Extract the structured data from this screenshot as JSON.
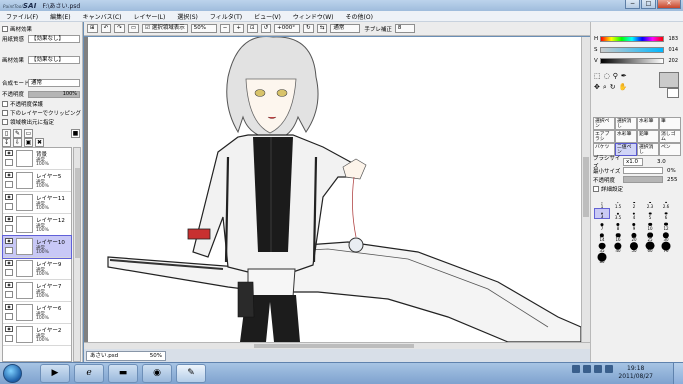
{
  "window": {
    "app_name": "PaintTool SAI",
    "app_short": "SAI",
    "app_prefix": "PaintTool",
    "title": "F:\\あさい.psd",
    "controls": [
      "−",
      "□",
      "✕"
    ]
  },
  "menu": [
    "ファイル(F)",
    "編集(E)",
    "キャンバス(C)",
    "レイヤー(L)",
    "選択(S)",
    "フィルタ(T)",
    "ビュー(V)",
    "ウィンドウ(W)",
    "その他(O)"
  ],
  "left_panel": {
    "header": "画材効果",
    "texture_label": "用紙質感",
    "texture_value": "【効果なし】",
    "material_label": "画材効果",
    "material_value": "【効果なし】",
    "blend_label": "合成モード",
    "blend_value": "通常",
    "opacity_label": "不透明度",
    "opacity_value": "100%",
    "opacity_fraction": 1.0,
    "checkboxes": [
      "不透明度保護",
      "下のレイヤーでクリッピング",
      "領域検出元に指定"
    ],
    "layer_icons": [
      "new-layer-icon",
      "new-linework-layer-icon",
      "new-folder-icon",
      "delete-layer-icon"
    ],
    "layers": [
      {
        "name": "背景",
        "mode": "通常",
        "opacity": "100%",
        "selected": false
      },
      {
        "name": "レイヤー5",
        "mode": "通常",
        "opacity": "100%",
        "selected": false
      },
      {
        "name": "レイヤー11",
        "mode": "通常",
        "opacity": "100%",
        "selected": false
      },
      {
        "name": "レイヤー12",
        "mode": "通常",
        "opacity": "100%",
        "selected": false
      },
      {
        "name": "レイヤー10",
        "mode": "通常",
        "opacity": "100%",
        "selected": true
      },
      {
        "name": "レイヤー9",
        "mode": "通常",
        "opacity": "100%",
        "selected": false
      },
      {
        "name": "レイヤー7",
        "mode": "通常",
        "opacity": "100%",
        "selected": false
      },
      {
        "name": "レイヤー6",
        "mode": "通常",
        "opacity": "100%",
        "selected": false
      },
      {
        "name": "レイヤー2",
        "mode": "通常",
        "opacity": "100%",
        "selected": false
      }
    ]
  },
  "canvas_toolbar": {
    "show_selection_label": "選択領域表示",
    "zoom": "50%",
    "rotation": "+000°",
    "blend": "通常",
    "stabilizer_label": "手ブレ補正",
    "stabilizer_value": "8"
  },
  "document_tab": {
    "name": "あさい.psd",
    "zoom": "50%"
  },
  "right_panel": {
    "hsv": [
      {
        "label": "H",
        "value": "183",
        "color": "#ff0000"
      },
      {
        "label": "S",
        "value": "014",
        "color": "#00b7ff"
      },
      {
        "label": "V",
        "value": "202",
        "color": "#cacaca"
      }
    ],
    "tools": [
      "選択ペン",
      "選択消し",
      "水彩筆",
      "筆",
      "エアブラシ",
      "水彩筆",
      "鉛筆",
      "消しゴム",
      "バケツ",
      "二値ペン",
      "選択消し",
      "ペン"
    ],
    "brush_size_label": "ブラシサイズ",
    "brush_size_mult": "x1.0",
    "brush_size_value": "3.0",
    "min_size_label": "最小サイズ",
    "min_size_value": "0%",
    "density_label": "不透明度",
    "density_value": "255",
    "detail_label": "詳細設定",
    "brush_sizes": [
      "1",
      "1.5",
      "2",
      "2.3",
      "2.6",
      "3",
      "3.5",
      "4",
      "5",
      "6",
      "7",
      "8",
      "9",
      "10",
      "12",
      "14",
      "16",
      "20",
      "25",
      "30",
      "35",
      "40",
      "50",
      "60",
      "70",
      "80"
    ],
    "selected_brush_size": "3"
  },
  "taskbar": {
    "time": "19:18",
    "date": "2011/08/27",
    "apps": [
      "ie-icon",
      "explorer-icon",
      "media-player-icon",
      "firefox-icon",
      "sai-icon"
    ]
  }
}
